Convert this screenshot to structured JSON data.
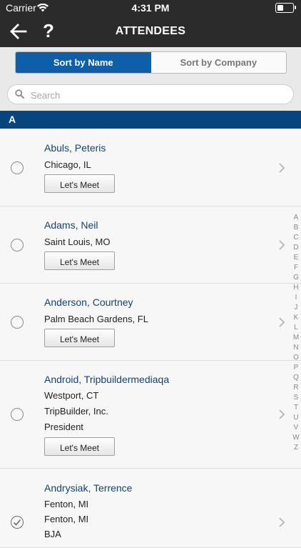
{
  "status": {
    "carrier": "Carrier",
    "time": "4:31 PM"
  },
  "nav": {
    "title": "ATTENDEES",
    "help_label": "?"
  },
  "sort": {
    "by_name": "Sort by Name",
    "by_company": "Sort by Company",
    "selected": "Sort by Name"
  },
  "search": {
    "placeholder": "Search",
    "value": ""
  },
  "section": {
    "letter": "A"
  },
  "meet_label": "Let's Meet",
  "attendees": [
    {
      "name": "Abuls, Peteris",
      "lines": [
        "Chicago, IL"
      ],
      "checked": false
    },
    {
      "name": "Adams, Neil",
      "lines": [
        "Saint Louis, MO"
      ],
      "checked": false
    },
    {
      "name": "Anderson, Courtney",
      "lines": [
        "Palm Beach Gardens, FL"
      ],
      "checked": false
    },
    {
      "name": "Android, Tripbuildermediaqa",
      "lines": [
        "Westport, CT",
        "TripBuilder, Inc.",
        "President"
      ],
      "checked": false
    },
    {
      "name": "Andrysiak, Terrence",
      "lines": [
        "Fenton, MI",
        "Fenton, MI",
        "BJA"
      ],
      "checked": true
    }
  ],
  "index_letters": [
    "A",
    "B",
    "C",
    "D",
    "E",
    "F",
    "G",
    "H",
    "I",
    "J",
    "K",
    "L",
    "M",
    "N",
    "O",
    "P",
    "Q",
    "R",
    "S",
    "T",
    "U",
    "V",
    "W",
    "Z"
  ],
  "colors": {
    "accent": "#0e5ea9",
    "section": "#06457e",
    "name": "#10437d",
    "topbar": "#2b2b2b"
  }
}
